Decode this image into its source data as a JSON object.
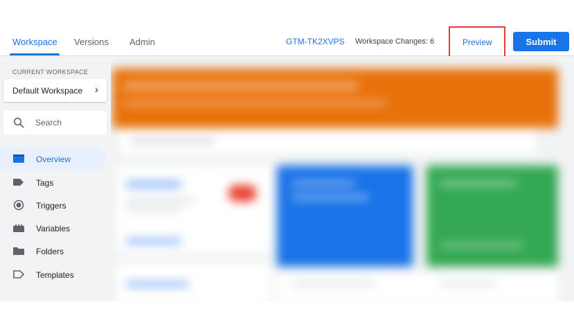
{
  "header": {
    "tabs": [
      {
        "label": "Workspace",
        "active": true
      },
      {
        "label": "Versions",
        "active": false
      },
      {
        "label": "Admin",
        "active": false
      }
    ],
    "container_id": "GTM-TK2XVPS",
    "workspace_changes": "Workspace Changes: 6",
    "preview_label": "Preview",
    "submit_label": "Submit"
  },
  "sidebar": {
    "current_workspace_caption": "CURRENT WORKSPACE",
    "workspace_name": "Default Workspace",
    "search_placeholder": "Search",
    "items": [
      {
        "label": "Overview",
        "icon": "overview-icon",
        "active": true
      },
      {
        "label": "Tags",
        "icon": "tag-icon",
        "active": false
      },
      {
        "label": "Triggers",
        "icon": "trigger-icon",
        "active": false
      },
      {
        "label": "Variables",
        "icon": "variables-icon",
        "active": false
      },
      {
        "label": "Folders",
        "icon": "folder-icon",
        "active": false
      },
      {
        "label": "Templates",
        "icon": "template-icon",
        "active": false
      }
    ]
  },
  "colors": {
    "accent": "#1a73e8",
    "highlight_box": "#e53935",
    "orange_card": "#e8710a",
    "blue_card": "#1a73e8",
    "green_card": "#34a853",
    "sidebar_bg": "#f1f3f4"
  }
}
